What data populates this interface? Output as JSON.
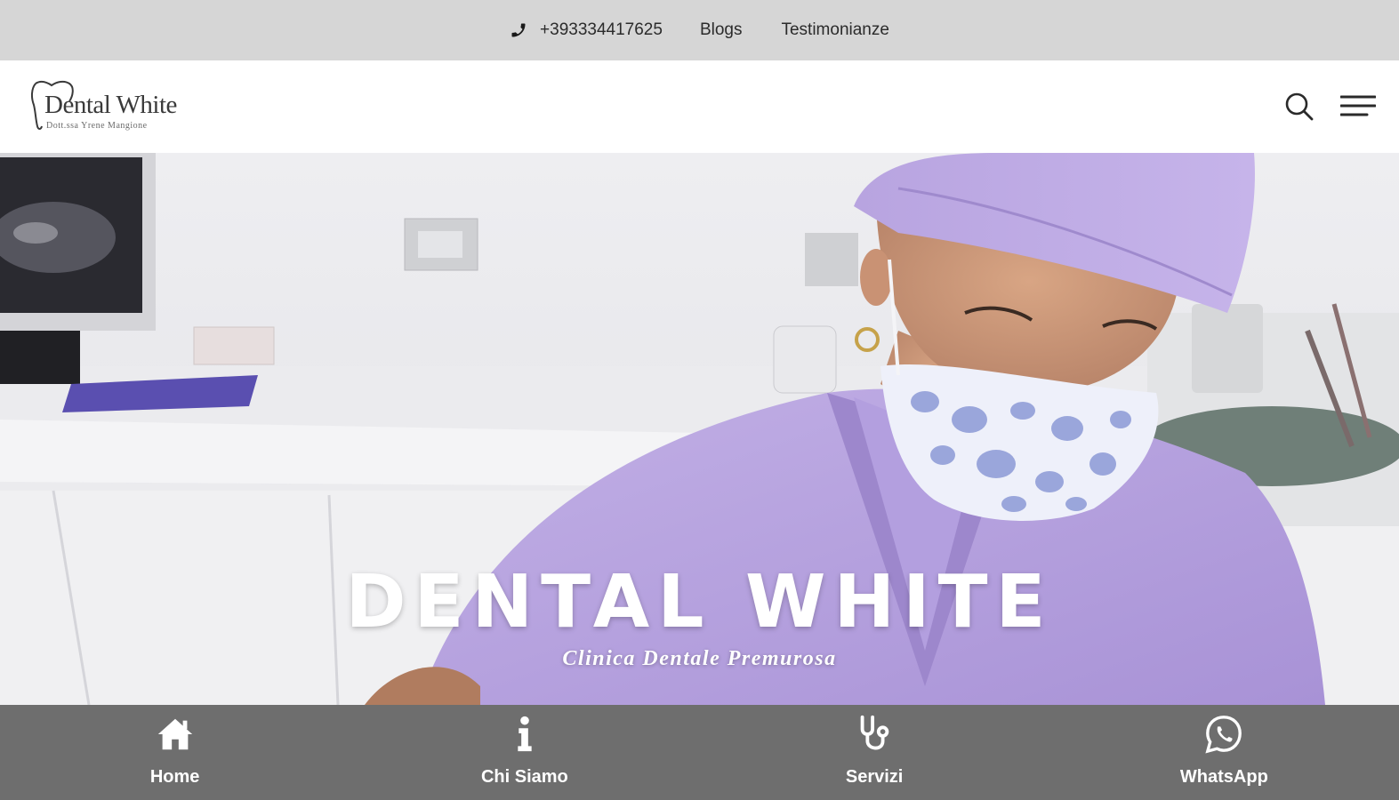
{
  "topbar": {
    "phone": "+393334417625",
    "links": [
      "Blogs",
      "Testimonianze"
    ]
  },
  "header": {
    "logo": {
      "brand": "Dental White",
      "tagline": "Dott.ssa Yrene Mangione"
    },
    "icons": [
      "search-icon",
      "menu-icon"
    ]
  },
  "hero": {
    "title": "DENTAL WHITE",
    "subtitle": "Clinica Dentale Premurosa"
  },
  "bottom_nav": {
    "items": [
      {
        "label": "Home",
        "icon": "home-icon"
      },
      {
        "label": "Chi Siamo",
        "icon": "info-icon"
      },
      {
        "label": "Servizi",
        "icon": "stethoscope-icon"
      },
      {
        "label": "WhatsApp",
        "icon": "whatsapp-icon"
      }
    ]
  },
  "colors": {
    "topbar_bg": "#d6d6d6",
    "header_bg": "#ffffff",
    "bottom_nav_bg": "#6e6e6e",
    "scrubs_lavender": "#b4a0de"
  }
}
